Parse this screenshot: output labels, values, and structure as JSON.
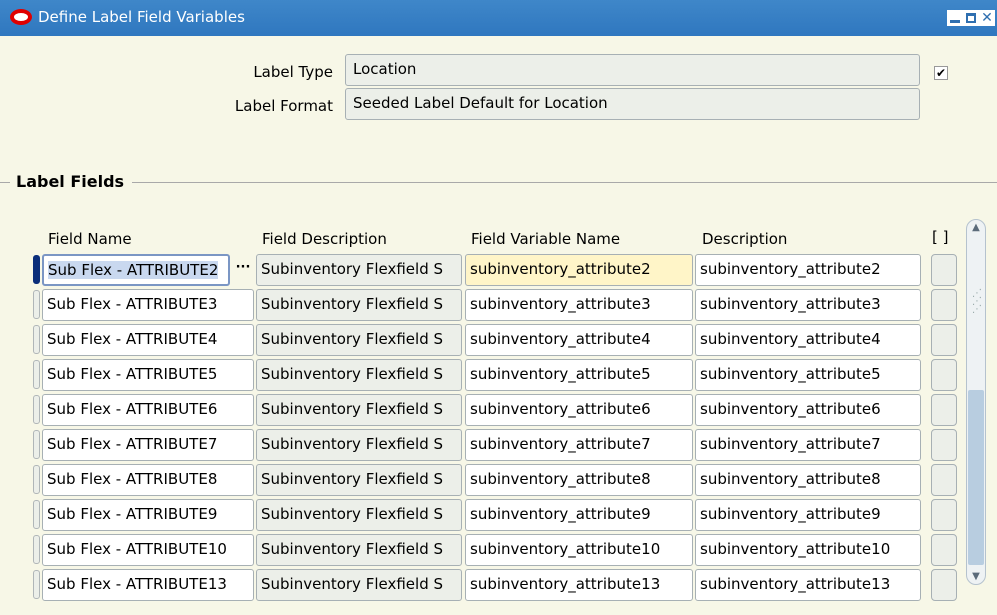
{
  "window": {
    "title": "Define Label Field Variables"
  },
  "header": {
    "label_type_label": "Label Type",
    "label_type_value": "Location",
    "label_format_label": "Label Format",
    "label_format_value": "Seeded Label Default for Location",
    "checkbox_checked": true,
    "checkbox_glyph": "✔"
  },
  "section": {
    "title": "Label Fields"
  },
  "columns": {
    "field_name": "Field Name",
    "field_description": "Field Description",
    "field_variable_name": "Field Variable Name",
    "description": "Description",
    "flex": "[ ]"
  },
  "lov_glyph": "···",
  "rows": [
    {
      "field_name": "Sub Flex - ATTRIBUTE2",
      "field_description": "Subinventory Flexfield S",
      "field_variable_name": "subinventory_attribute2",
      "description": "subinventory_attribute2"
    },
    {
      "field_name": "Sub Flex - ATTRIBUTE3",
      "field_description": "Subinventory Flexfield S",
      "field_variable_name": "subinventory_attribute3",
      "description": "subinventory_attribute3"
    },
    {
      "field_name": "Sub Flex - ATTRIBUTE4",
      "field_description": "Subinventory Flexfield S",
      "field_variable_name": "subinventory_attribute4",
      "description": "subinventory_attribute4"
    },
    {
      "field_name": "Sub Flex - ATTRIBUTE5",
      "field_description": "Subinventory Flexfield S",
      "field_variable_name": "subinventory_attribute5",
      "description": "subinventory_attribute5"
    },
    {
      "field_name": "Sub Flex - ATTRIBUTE6",
      "field_description": "Subinventory Flexfield S",
      "field_variable_name": "subinventory_attribute6",
      "description": "subinventory_attribute6"
    },
    {
      "field_name": "Sub Flex - ATTRIBUTE7",
      "field_description": "Subinventory Flexfield S",
      "field_variable_name": "subinventory_attribute7",
      "description": "subinventory_attribute7"
    },
    {
      "field_name": "Sub Flex - ATTRIBUTE8",
      "field_description": "Subinventory Flexfield S",
      "field_variable_name": "subinventory_attribute8",
      "description": "subinventory_attribute8"
    },
    {
      "field_name": "Sub Flex - ATTRIBUTE9",
      "field_description": "Subinventory Flexfield S",
      "field_variable_name": "subinventory_attribute9",
      "description": "subinventory_attribute9"
    },
    {
      "field_name": "Sub Flex - ATTRIBUTE10",
      "field_description": "Subinventory Flexfield S",
      "field_variable_name": "subinventory_attribute10",
      "description": "subinventory_attribute10"
    },
    {
      "field_name": "Sub Flex - ATTRIBUTE13",
      "field_description": "Subinventory Flexfield S",
      "field_variable_name": "subinventory_attribute13",
      "description": "subinventory_attribute13"
    }
  ],
  "colors": {
    "titlebar": "#3a82c6",
    "current_record": "#0b2e7a",
    "highlight_field": "#fff5c8"
  }
}
